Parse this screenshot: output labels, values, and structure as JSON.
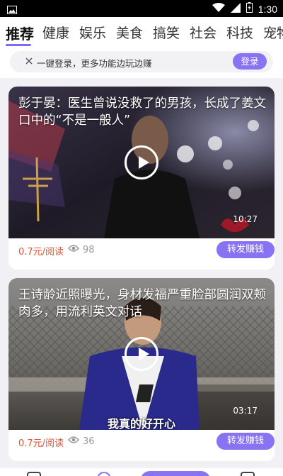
{
  "status_bar": {
    "time": "1:30",
    "icons": [
      "image-icon",
      "wifi-icon",
      "signal-icon",
      "battery-icon"
    ]
  },
  "tabs": [
    {
      "label": "推荐",
      "active": true
    },
    {
      "label": "健康"
    },
    {
      "label": "娱乐"
    },
    {
      "label": "美食"
    },
    {
      "label": "搞笑"
    },
    {
      "label": "社会"
    },
    {
      "label": "科技"
    },
    {
      "label": "宠物"
    }
  ],
  "login_banner": {
    "text": "一键登录，更多功能边玩边赚",
    "button": "登录"
  },
  "cards": [
    {
      "title": "彭于晏：医生曾说没救了的男孩，长成了姜文口中的“不是一般人”",
      "duration": "10:27",
      "subtitle": "",
      "price": "0.7元/阅读",
      "views": "98",
      "share_label": "转发赚钱"
    },
    {
      "title": "王诗龄近照曝光，身材发福严重脸部圆润双颊肉多，用流利英文对话",
      "duration": "03:17",
      "subtitle": "我真的好开心",
      "price": "0.7元/阅读",
      "views": "36",
      "share_label": "转发赚钱"
    }
  ],
  "colors": {
    "accent": "#8a73f3",
    "price": "#e2553a",
    "background": "#f1f1f5"
  }
}
